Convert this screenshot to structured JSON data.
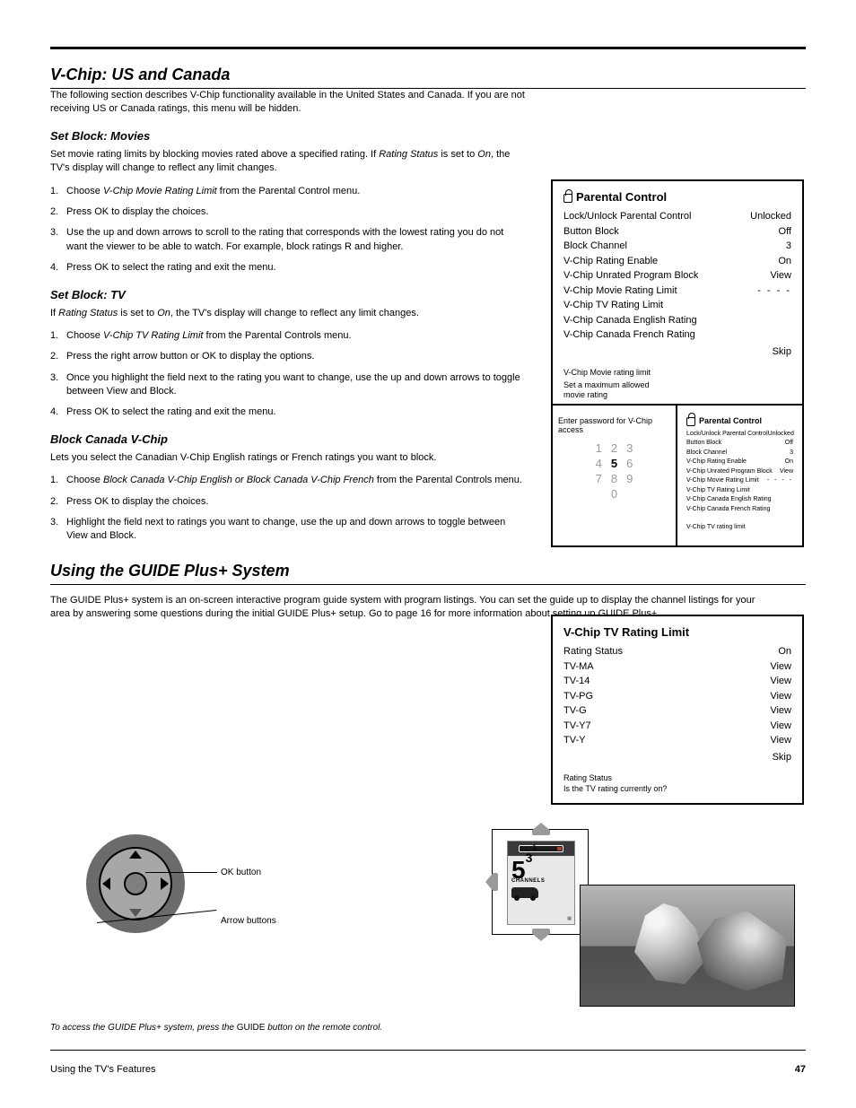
{
  "page": {
    "number": "47",
    "footer_section": "Using the TV's Features"
  },
  "sections": {
    "main_title": "V-Chip: US and Canada",
    "intro": "The following section describes V-Chip functionality available in the United States and Canada. If you are not receiving US or Canada ratings, this menu will be hidden.",
    "set_block_movie": {
      "title": "Set Block: Movies",
      "p1_prefix": "Set movie rating limits by blocking movies rated above a specified rating. If ",
      "p1_status": "Rating Status ",
      "p1_mid": "is set to ",
      "p1_on": "On",
      "p1_suffix": ", the TV's display will change to reflect any limit changes.",
      "steps": [
        {
          "n": "1.",
          "before": "Choose ",
          "hi": "V-Chip Movie Rating Limit",
          "after": " from the Parental Control menu."
        },
        {
          "n": "2.",
          "before": "Press ",
          "hi": "OK",
          "after": " to display the choices."
        },
        {
          "n": "3.",
          "before": "",
          "hi": "",
          "after": "Use the up and down arrows to scroll to the rating that corresponds with the lowest rating you do not want the viewer to be able to watch. For example, block ratings R and higher."
        },
        {
          "n": "4.",
          "before": "Press ",
          "hi": "OK",
          "after": " to select the rating and exit the menu."
        }
      ]
    },
    "set_block_tv": {
      "title": "Set Block: TV",
      "p1_before": "If ",
      "p1_status": "Rating Status ",
      "p1_mid": "is set to ",
      "p1_on": "On",
      "p1_after": ", the TV's display will change to reflect any limit changes.",
      "steps": [
        {
          "n": "1.",
          "before": "Choose ",
          "hi": "V-Chip TV Rating Limit",
          "after": " from the Parental Controls menu."
        },
        {
          "n": "2.",
          "before": "Press the right arrow button or ",
          "hi": "OK",
          "after": " to display the options."
        },
        {
          "n": "3.",
          "before": "",
          "hi": "",
          "after": "Once you highlight the field next to the rating you want to change, use the up and down arrows to toggle between View and Block."
        },
        {
          "n": "4.",
          "before": "Press ",
          "hi": "OK",
          "after": " to select the rating and exit the menu."
        }
      ]
    },
    "block_canada": {
      "title": "Block Canada V-Chip",
      "p1": "Lets you select the Canadian V-Chip English ratings or French ratings you want to block.",
      "steps": [
        {
          "n": "1.",
          "before": "Choose ",
          "hi": "Block Canada V-Chip English or Block Canada V-Chip French",
          "after": " from the Parental Controls menu."
        },
        {
          "n": "2.",
          "before": "Press ",
          "hi": "OK",
          "after": " to display the choices."
        },
        {
          "n": "3.",
          "before": "",
          "hi": "",
          "after": "Highlight the field next to ratings you want to change, use the up and down arrows to toggle between View and Block."
        }
      ]
    }
  },
  "panels": {
    "p1": {
      "title": "Parental Control",
      "lines": [
        [
          "Lock/Unlock Parental Control",
          "Unlocked"
        ],
        [
          "Button Block",
          "Off"
        ],
        [
          "Block Channel",
          "3"
        ],
        [
          "V-Chip Rating Enable",
          "On"
        ],
        [
          "V-Chip Unrated Program Block",
          "View"
        ],
        [
          "V-Chip Movie Rating Limit",
          "- - - -"
        ],
        [
          "V-Chip TV Rating Limit",
          ""
        ],
        [
          "V-Chip Canada English Rating",
          ""
        ],
        [
          "V-Chip Canada French Rating",
          ""
        ]
      ],
      "skip": "Skip",
      "sub1": "V-Chip Movie rating limit",
      "sub2": "Set a maximum allowed\nmovie rating"
    },
    "p2": {
      "left_title": "Enter password for V-Chip\naccess",
      "keys_row1": [
        "1",
        "2",
        "3"
      ],
      "keys_row2": [
        "4",
        "5",
        "6"
      ],
      "keys_row3": [
        "7",
        "8",
        "9"
      ],
      "keys_row4": [
        "",
        "0",
        ""
      ],
      "right_title": "Parental Control",
      "lines": [
        [
          "Lock/Unlock Parental Control",
          "Unlocked"
        ],
        [
          "Button Block",
          "Off"
        ],
        [
          "Block Channel",
          "3"
        ],
        [
          "V-Chip Rating Enable",
          "On"
        ],
        [
          "V-Chip Unrated Program Block",
          "View"
        ],
        [
          "V-Chip Movie Rating Limit",
          "- - - -"
        ],
        [
          "V-Chip TV Rating Limit",
          ""
        ],
        [
          "V-Chip Canada English Rating",
          ""
        ],
        [
          "V-Chip Canada French Rating",
          ""
        ]
      ],
      "sub": "V-Chip TV rating limit"
    },
    "p3": {
      "title": "V-Chip TV Rating Limit",
      "lines": [
        [
          "Rating Status",
          "On"
        ],
        [
          "TV-MA",
          "View"
        ],
        [
          "TV-14",
          "View"
        ],
        [
          "TV-PG",
          "View"
        ],
        [
          "TV-G",
          "View"
        ],
        [
          "TV-Y7",
          "View"
        ],
        [
          "TV-Y",
          "View"
        ]
      ],
      "skip": "Skip",
      "sub": "Rating Status\nIs the TV rating currently on?"
    }
  },
  "guide_section": {
    "title": "Using the GUIDE Plus+ System",
    "p1_before": "The GUIDE Plus+ system is an on-screen interactive program guide system with program listings. You can set the guide up to display the channel listings for your area by answering some questions during the initial GUIDE Plus+ setup. Go to page ",
    "p1_page": "16",
    "p1_after": " for more information about setting up GUIDE Plus+.",
    "thumbstick": {
      "ok_label": "OK button",
      "arrows_label": "Arrow buttons"
    },
    "preview": {
      "big": "5",
      "sup": "3",
      "exp": "1",
      "channels": "CHANNELS"
    },
    "caption_prefix": "To access the GUIDE Plus+ system, press the ",
    "caption_guide": "GUIDE",
    "caption_suffix": " button on the remote control."
  }
}
